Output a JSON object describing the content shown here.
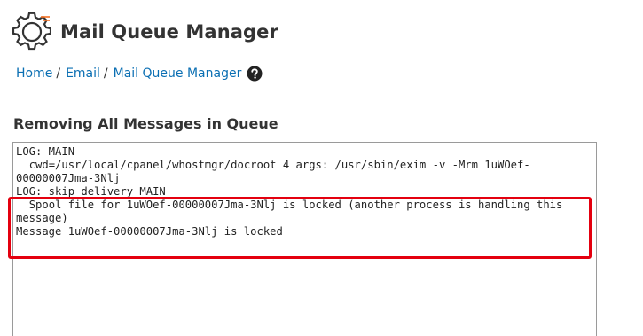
{
  "header": {
    "title": "Mail Queue Manager",
    "icon": "gear-icon",
    "accent_color": "#f36f21"
  },
  "breadcrumb": {
    "items": [
      {
        "label": "Home"
      },
      {
        "label": "Email"
      },
      {
        "label": "Mail Queue Manager"
      }
    ],
    "separator": "/",
    "help_icon": "question-circle-icon",
    "link_color": "#0b6fb3"
  },
  "section": {
    "title": "Removing All Messages in Queue"
  },
  "log": {
    "lines": [
      "LOG: MAIN",
      "  cwd=/usr/local/cpanel/whostmgr/docroot 4 args: /usr/sbin/exim -v -Mrm 1uWOef-00000007Jma-3Nlj",
      "LOG: skip_delivery MAIN",
      "  Spool file for 1uWOef-00000007Jma-3Nlj is locked (another process is handling this message)",
      "Message 1uWOef-00000007Jma-3Nlj is locked"
    ]
  },
  "highlight": {
    "color": "#e4000f"
  }
}
